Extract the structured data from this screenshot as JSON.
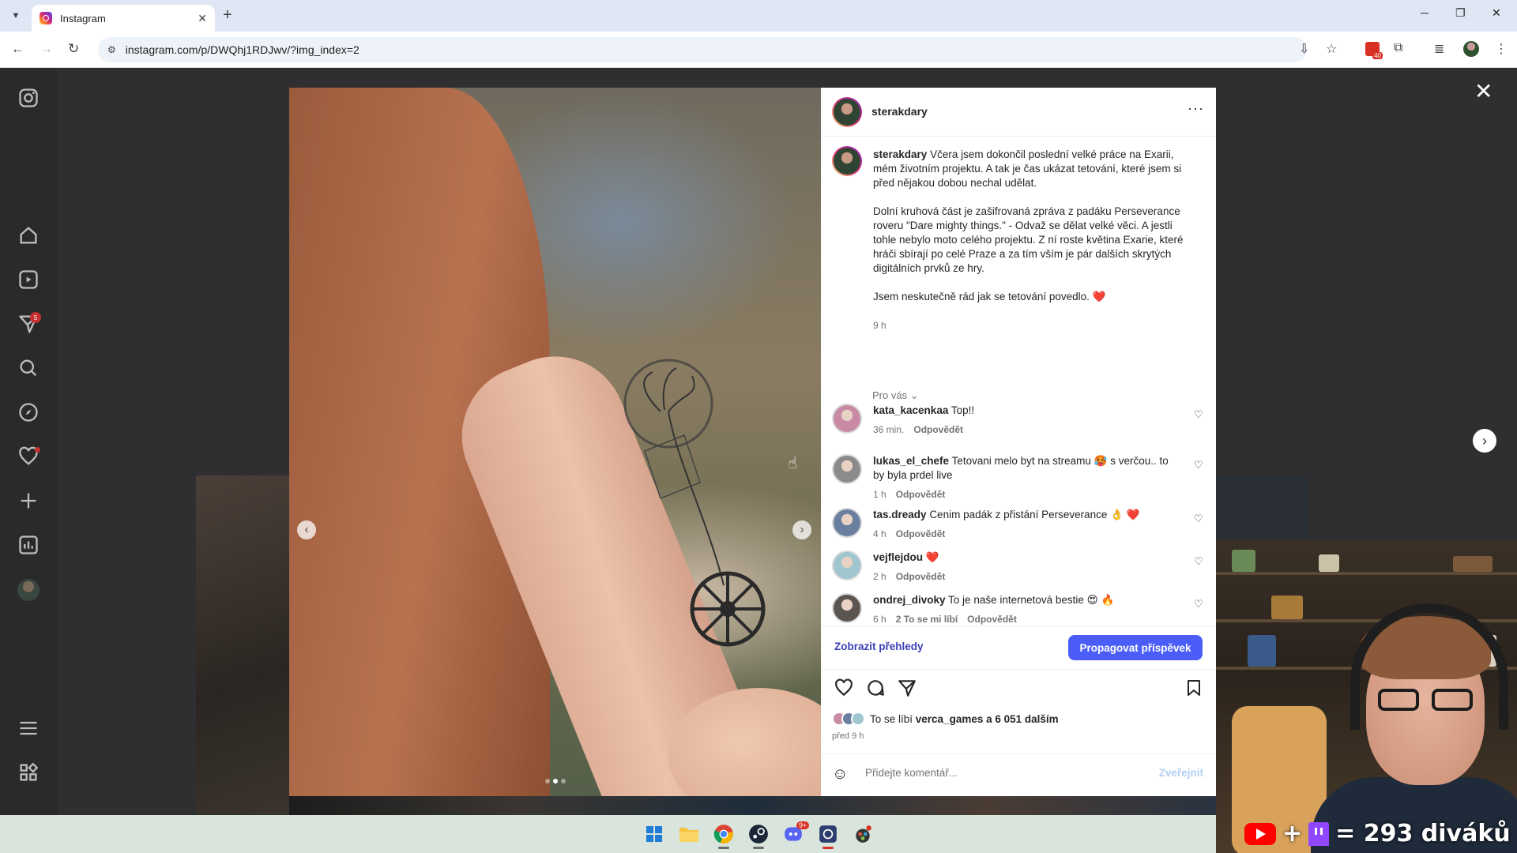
{
  "browser": {
    "tab_title": "Instagram",
    "url": "instagram.com/p/DWQhj1RDJwv/?img_index=2",
    "extension_badge": "40"
  },
  "sidebar": {
    "notifications_badge": "5",
    "icons": [
      "instagram-icon",
      "home-icon",
      "reels-icon",
      "messages-icon",
      "search-icon",
      "explore-icon",
      "notifications-icon",
      "create-icon",
      "dashboard-icon",
      "profile-avatar",
      "more-menu-icon",
      "meta-apps-icon"
    ]
  },
  "post": {
    "author": "sterakdary",
    "caption_paragraphs": [
      "Včera jsem dokončil poslední velké práce na Exarii, mém životním projektu. A tak je čas ukázat tetování, které jsem si před nějakou dobou nechal udělat.",
      "Dolní kruhová část je zašifrovaná zpráva z padáku Perseverance roveru \"Dare mighty things.\" - Odvaž se dělat velké věci. A jestli tohle nebylo moto celého projektu. Z ní roste květina Exarie, které hráči sbírají po celé Praze a za tím vším je pár dalších skrytých digitálních prvků ze hry.",
      "Jsem neskutečně rád jak se tetování povedlo. ❤️"
    ],
    "caption_time": "9 h",
    "filter_label": "Pro vás",
    "comments": [
      {
        "user": "kata_kacenkaa",
        "text": "Top!!",
        "time": "36 min.",
        "likes": "",
        "reply": "Odpovědět",
        "avatar_color": "#c98aa6"
      },
      {
        "user": "lukas_el_chefe",
        "text": "Tetovani melo byt na streamu 🥵 s verčou.. to by byla prdel live",
        "time": "1 h",
        "likes": "",
        "reply": "Odpovědět",
        "avatar_color": "#8b8b8b"
      },
      {
        "user": "tas.dready",
        "text": "Cenim padák z přistání Perseverance 👌 ❤️",
        "time": "4 h",
        "likes": "",
        "reply": "Odpovědět",
        "avatar_color": "#6a7fa0"
      },
      {
        "user": "vejflejdou",
        "text": "❤️",
        "time": "2 h",
        "likes": "",
        "reply": "Odpovědět",
        "avatar_color": "#9fc6cf"
      },
      {
        "user": "ondrej_divoky",
        "text": "To je naše internetová bestie 😍 🔥",
        "time": "6 h",
        "likes": "2 To se mi líbí",
        "reply": "Odpovědět",
        "avatar_color": "#5a5550"
      }
    ],
    "insights_label": "Zobrazit přehledy",
    "promote_label": "Propagovat příspěvek",
    "likes_prefix": "To se líbí ",
    "likes_user": "verca_games",
    "likes_suffix": " a 6 051 dalším",
    "posted_ago": "před 9 h",
    "comment_placeholder": "Přidejte komentář...",
    "post_button": "Zveřejnit",
    "carousel": {
      "count": 3,
      "active_index": 2
    }
  },
  "stream": {
    "viewer_text": "= 293 diváků"
  },
  "taskbar": {
    "apps": [
      "windows-start-icon",
      "file-explorer-icon",
      "chrome-icon",
      "steam-icon",
      "discord-icon",
      "app-icon",
      "davinci-icon"
    ],
    "discord_badge": "9+"
  },
  "colors": {
    "primary_button": "#4a5df9",
    "insights_link": "#3a3fb6",
    "notification_red": "#c7302e"
  }
}
